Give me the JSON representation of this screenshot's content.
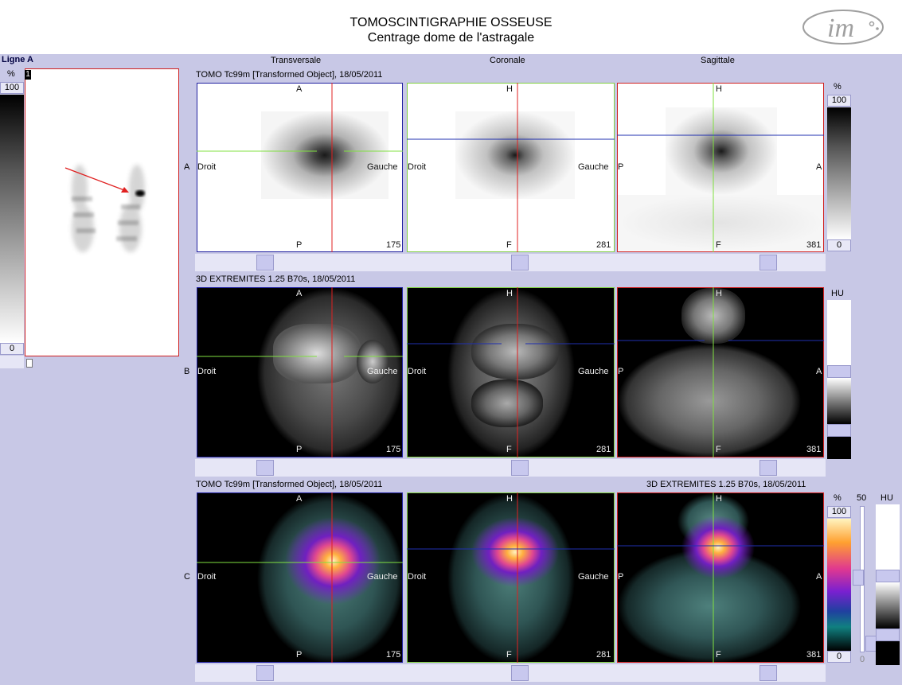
{
  "header": {
    "title": "TOMOSCINTIGRAPHIE OSSEUSE",
    "subtitle": "Centrage dome de l'astragale",
    "logo_text": "im"
  },
  "left": {
    "title": "Ligne A",
    "percent": "%",
    "max": "100",
    "min": "0",
    "index": "1"
  },
  "columns": {
    "transverse": "Transversale",
    "coronal": "Coronale",
    "sagittal": "Sagittale"
  },
  "rows": {
    "A": {
      "label": "A",
      "caption": "TOMO Tc99m [Transformed Object], 18/05/2011"
    },
    "B": {
      "label": "B",
      "caption": "3D EXTREMITES  1.25  B70s, 18/05/2011"
    },
    "C": {
      "label": "C",
      "caption_left": "TOMO Tc99m [Transformed Object], 18/05/2011",
      "caption_right": "3D EXTREMITES  1.25  B70s, 18/05/2011"
    }
  },
  "orient": {
    "transverse": {
      "top": "A",
      "bottom": "P",
      "left": "Droit",
      "right": "Gauche",
      "slice": "175"
    },
    "coronal": {
      "top": "H",
      "bottom": "F",
      "left": "Droit",
      "right": "Gauche",
      "slice": "281"
    },
    "sagittal": {
      "top": "H",
      "bottom": "F",
      "left": "P",
      "right": "A",
      "slice": "381"
    }
  },
  "scales": {
    "rowA": {
      "unit": "%",
      "max": "100",
      "min": "0"
    },
    "rowB": {
      "unit": "HU"
    },
    "rowC": {
      "unit": "%",
      "max": "100",
      "min": "0",
      "window": "50",
      "window_min": "0",
      "unit2": "HU"
    }
  },
  "colors": {
    "transverse_frame": "#2020a0",
    "coronal_frame": "#80d040",
    "sagittal_frame": "#d02020",
    "crosshair_v": "#e02020",
    "crosshair_h_green": "#80e040",
    "crosshair_h_blue": "#2030b0"
  }
}
